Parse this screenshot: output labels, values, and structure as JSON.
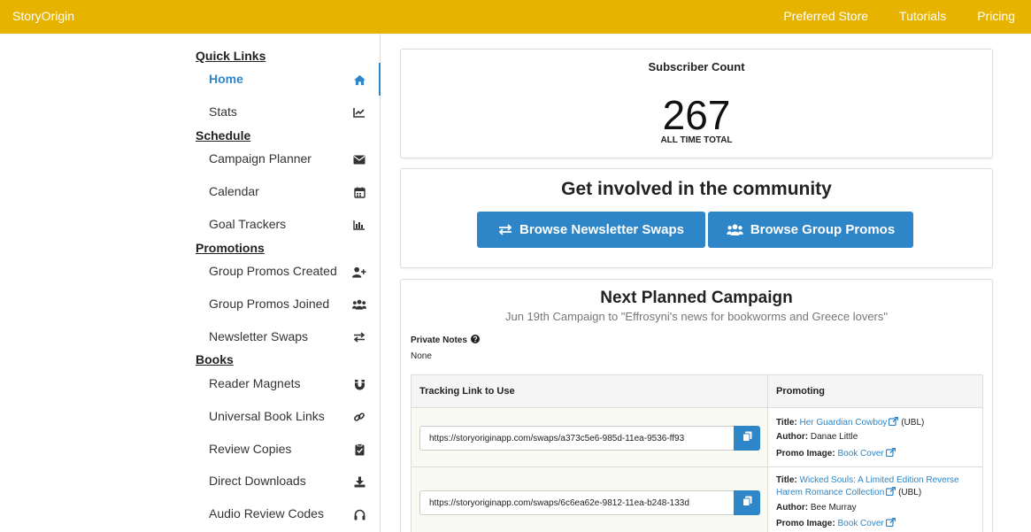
{
  "topbar": {
    "brand": "StoryOrigin",
    "nav": [
      "Preferred Store",
      "Tutorials",
      "Pricing"
    ]
  },
  "sidebar": {
    "sections": [
      {
        "title": "Quick Links",
        "items": [
          {
            "label": "Home",
            "icon": "home-icon",
            "active": true
          },
          {
            "label": "Stats",
            "icon": "chart-line-icon"
          }
        ]
      },
      {
        "title": "Schedule",
        "items": [
          {
            "label": "Campaign Planner",
            "icon": "envelope-icon"
          },
          {
            "label": "Calendar",
            "icon": "calendar-icon"
          },
          {
            "label": "Goal Trackers",
            "icon": "bar-chart-icon"
          }
        ]
      },
      {
        "title": "Promotions",
        "items": [
          {
            "label": "Group Promos Created",
            "icon": "user-plus-icon"
          },
          {
            "label": "Group Promos Joined",
            "icon": "users-icon"
          },
          {
            "label": "Newsletter Swaps",
            "icon": "exchange-icon"
          }
        ]
      },
      {
        "title": "Books",
        "items": [
          {
            "label": "Reader Magnets",
            "icon": "magnet-icon"
          },
          {
            "label": "Universal Book Links",
            "icon": "link-icon"
          },
          {
            "label": "Review Copies",
            "icon": "clipboard-check-icon"
          },
          {
            "label": "Direct Downloads",
            "icon": "download-icon"
          },
          {
            "label": "Audio Review Codes",
            "icon": "headphones-icon"
          }
        ]
      }
    ]
  },
  "subscriber": {
    "title": "Subscriber Count",
    "count": "267",
    "caption": "ALL TIME TOTAL"
  },
  "community": {
    "title": "Get involved in the community",
    "swaps_button": "Browse Newsletter Swaps",
    "promos_button": "Browse Group Promos"
  },
  "campaign": {
    "title": "Next Planned Campaign",
    "subtitle": "Jun 19th Campaign to \"Effrosyni's news for bookworms and Greece lovers\"",
    "notes_label": "Private Notes",
    "notes_value": "None",
    "columns": [
      "Tracking Link to Use",
      "Promoting"
    ],
    "rows": [
      {
        "link": "https://storyoriginapp.com/swaps/a373c5e6-985d-11ea-9536-ff93",
        "title_label": "Title:",
        "title_lines": [
          "Her Guardian Cowboy"
        ],
        "title_suffix": "(UBL)",
        "author_label": "Author:",
        "author": "Danae Little",
        "image_label": "Promo Image:",
        "image_link": "Book Cover"
      },
      {
        "link": "https://storyoriginapp.com/swaps/6c6ea62e-9812-11ea-b248-133d",
        "title_label": "Title:",
        "title_lines": [
          "Wicked Souls: A Limited Edition Reverse",
          "Harem Romance Collection"
        ],
        "title_suffix": "(UBL)",
        "author_label": "Author:",
        "author": "Bee Murray",
        "image_label": "Promo Image:",
        "image_link": "Book Cover"
      }
    ]
  },
  "colors": {
    "topbar": "#e5b300",
    "accent": "#2e86c8",
    "row_highlight": "#f9fbf2"
  }
}
